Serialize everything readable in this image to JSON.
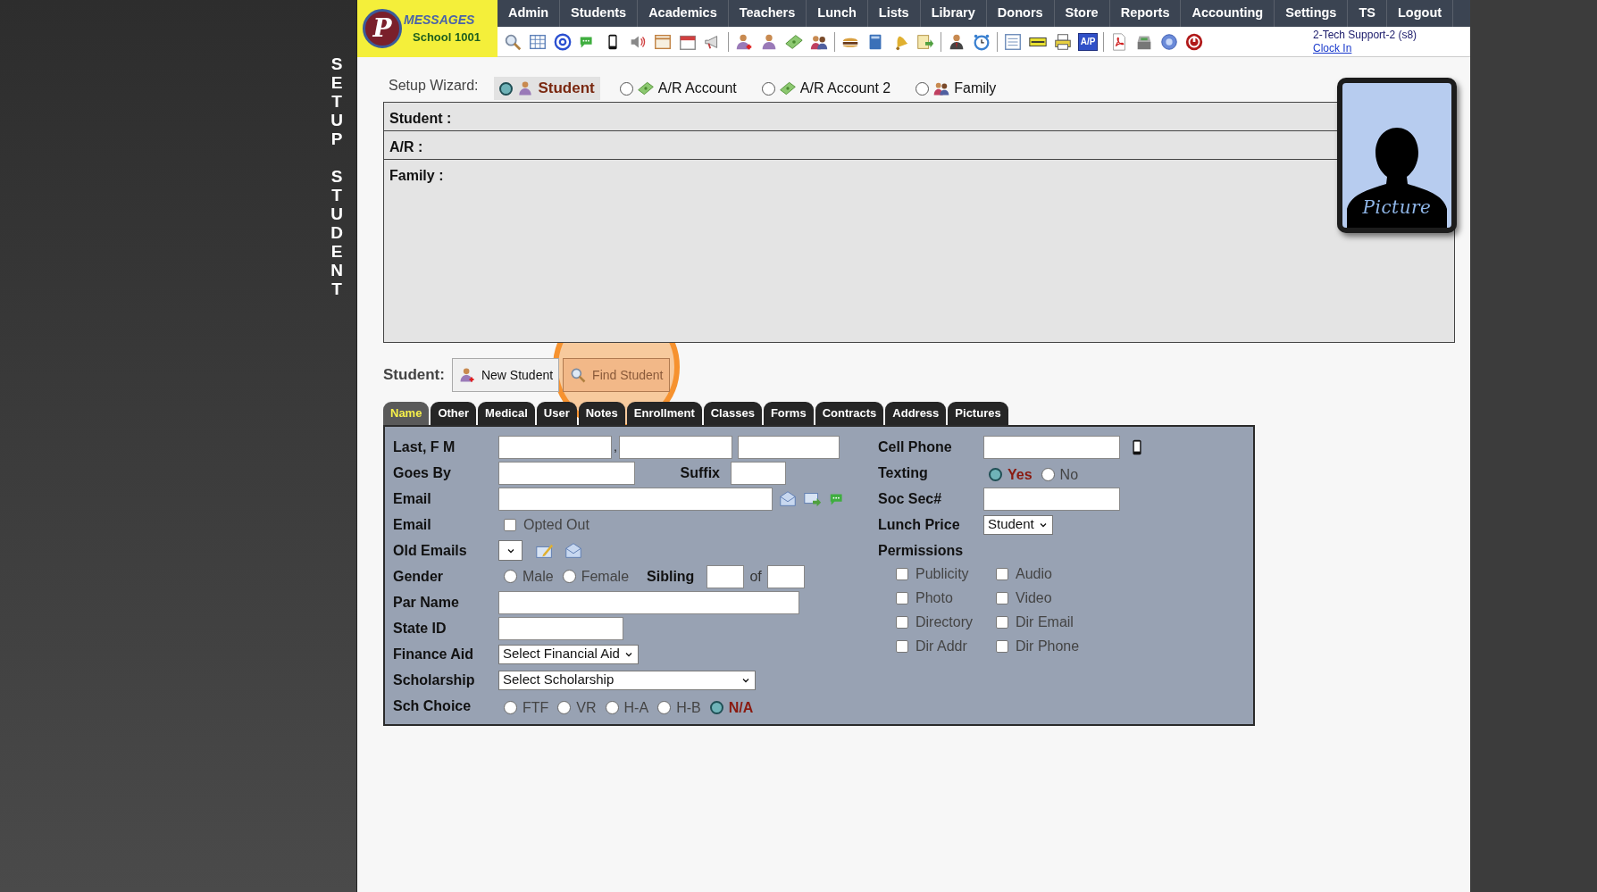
{
  "side_title": "SETUP STUDENT",
  "logo": {
    "letter": "P",
    "title": "MESSAGES",
    "subtitle": "School 1001"
  },
  "nav": [
    "Admin",
    "Students",
    "Academics",
    "Teachers",
    "Lunch",
    "Lists",
    "Library",
    "Donors",
    "Store",
    "Reports",
    "Accounting",
    "Settings",
    "TS",
    "Logout"
  ],
  "toolbar_badge": "A/P",
  "user": {
    "name": "2-Tech Support-2 (s8)",
    "link": "Clock In"
  },
  "wizard": {
    "label": "Setup Wizard:",
    "steps": [
      {
        "label": "Student",
        "kind": "student",
        "selected": true
      },
      {
        "label": "A/R Account",
        "kind": "account",
        "selected": false
      },
      {
        "label": "A/R Account 2",
        "kind": "account",
        "selected": false
      },
      {
        "label": "Family",
        "kind": "family",
        "selected": false
      }
    ]
  },
  "summary": [
    "Student :",
    "A/R :",
    "Family :"
  ],
  "picture": {
    "caption": "Picture"
  },
  "student_actions": {
    "label": "Student:",
    "buttons": [
      {
        "label": "New Student",
        "kind": "new",
        "highlighted": false
      },
      {
        "label": "Find Student",
        "kind": "find",
        "highlighted": true
      }
    ]
  },
  "tabs": [
    {
      "label": "Name",
      "selected": true
    },
    {
      "label": "Other",
      "selected": false
    },
    {
      "label": "Medical",
      "selected": false
    },
    {
      "label": "User",
      "selected": false
    },
    {
      "label": "Notes",
      "selected": false
    },
    {
      "label": "Enrollment",
      "selected": false
    },
    {
      "label": "Classes",
      "selected": false
    },
    {
      "label": "Forms",
      "selected": false
    },
    {
      "label": "Contracts",
      "selected": false
    },
    {
      "label": "Address",
      "selected": false
    },
    {
      "label": "Pictures",
      "selected": false
    }
  ],
  "form": {
    "left": [
      {
        "kind": "name",
        "label": "Last, F M",
        "separator": ","
      },
      {
        "kind": "goes_by",
        "label": "Goes By",
        "suffix_label": "Suffix"
      },
      {
        "kind": "email",
        "label": "Email"
      },
      {
        "kind": "checkbox",
        "label": "Email",
        "option": "Opted Out",
        "checked": false
      },
      {
        "kind": "old_emails",
        "label": "Old Emails"
      },
      {
        "kind": "gender",
        "label": "Gender",
        "options": [
          {
            "label": "Male",
            "selected": false
          },
          {
            "label": "Female",
            "selected": false
          }
        ],
        "sibling_label": "Sibling",
        "of_label": "of"
      },
      {
        "kind": "text_wide",
        "label": "Par Name"
      },
      {
        "kind": "text_short",
        "label": "State ID"
      },
      {
        "kind": "select",
        "label": "Finance Aid",
        "value": "Select Financial Aid"
      },
      {
        "kind": "select_wide",
        "label": "Scholarship",
        "value": "Select Scholarship"
      },
      {
        "kind": "radios",
        "label": "Sch Choice",
        "options": [
          {
            "label": "FTF",
            "selected": false
          },
          {
            "label": "VR",
            "selected": false
          },
          {
            "label": "H-A",
            "selected": false
          },
          {
            "label": "H-B",
            "selected": false
          },
          {
            "label": "N/A",
            "selected": true
          }
        ]
      }
    ],
    "right": [
      {
        "kind": "phone",
        "label": "Cell Phone"
      },
      {
        "kind": "radios",
        "label": "Texting",
        "options": [
          {
            "label": "Yes",
            "selected": true
          },
          {
            "label": "No",
            "selected": false
          }
        ]
      },
      {
        "kind": "text",
        "label": "Soc Sec#"
      },
      {
        "kind": "select",
        "label": "Lunch Price",
        "value": "Student"
      },
      {
        "kind": "heading",
        "label": "Permissions"
      }
    ],
    "permissions": [
      {
        "label": "Publicity",
        "checked": false
      },
      {
        "label": "Audio",
        "checked": false
      },
      {
        "label": "Photo",
        "checked": false
      },
      {
        "label": "Video",
        "checked": false
      },
      {
        "label": "Directory",
        "checked": false
      },
      {
        "label": "Dir Email",
        "checked": false
      },
      {
        "label": "Dir Addr",
        "checked": false
      },
      {
        "label": "Dir Phone",
        "checked": false
      }
    ]
  }
}
